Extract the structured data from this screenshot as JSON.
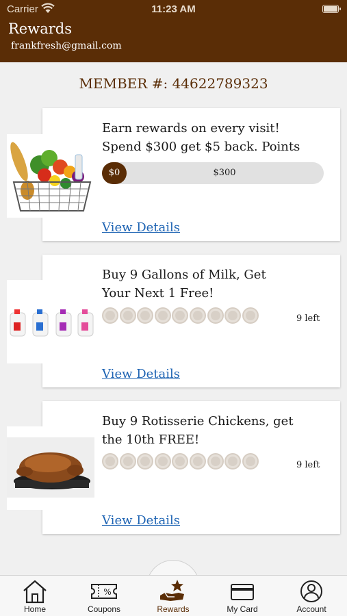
{
  "status": {
    "carrier": "Carrier",
    "time": "11:23 AM"
  },
  "header": {
    "title": "Rewards",
    "email": "frankfresh@gmail.com"
  },
  "member": {
    "label": "MEMBER #: 44622789323"
  },
  "cards": [
    {
      "title_line1": "Earn rewards on every visit!",
      "title_line2": "Spend $300 get $5 back. Points",
      "progress_start": "$0",
      "progress_end": "$300",
      "progress_fraction": 0,
      "link": "View Details",
      "image": "grocery-basket"
    },
    {
      "title_line1": "Buy 9 Gallons of Milk, Get",
      "title_line2": "Your Next 1 Free!",
      "punch_total": 9,
      "punch_used": 0,
      "remaining": "9 left",
      "link": "View Details",
      "image": "milk-jugs"
    },
    {
      "title_line1": "Buy 9 Rotisserie Chickens, get",
      "title_line2": "the 10th FREE!",
      "punch_total": 9,
      "punch_used": 0,
      "remaining": "9 left",
      "link": "View Details",
      "image": "rotisserie-chicken"
    }
  ],
  "tabs": [
    {
      "label": "Home",
      "icon": "house-icon"
    },
    {
      "label": "Coupons",
      "icon": "ticket-icon"
    },
    {
      "label": "Rewards",
      "icon": "star-hand-icon",
      "active": true
    },
    {
      "label": "My Card",
      "icon": "card-icon"
    },
    {
      "label": "Account",
      "icon": "person-icon"
    }
  ],
  "colors": {
    "brand": "#5a2d06",
    "link": "#1d63b3",
    "background": "#f0f0f0"
  }
}
